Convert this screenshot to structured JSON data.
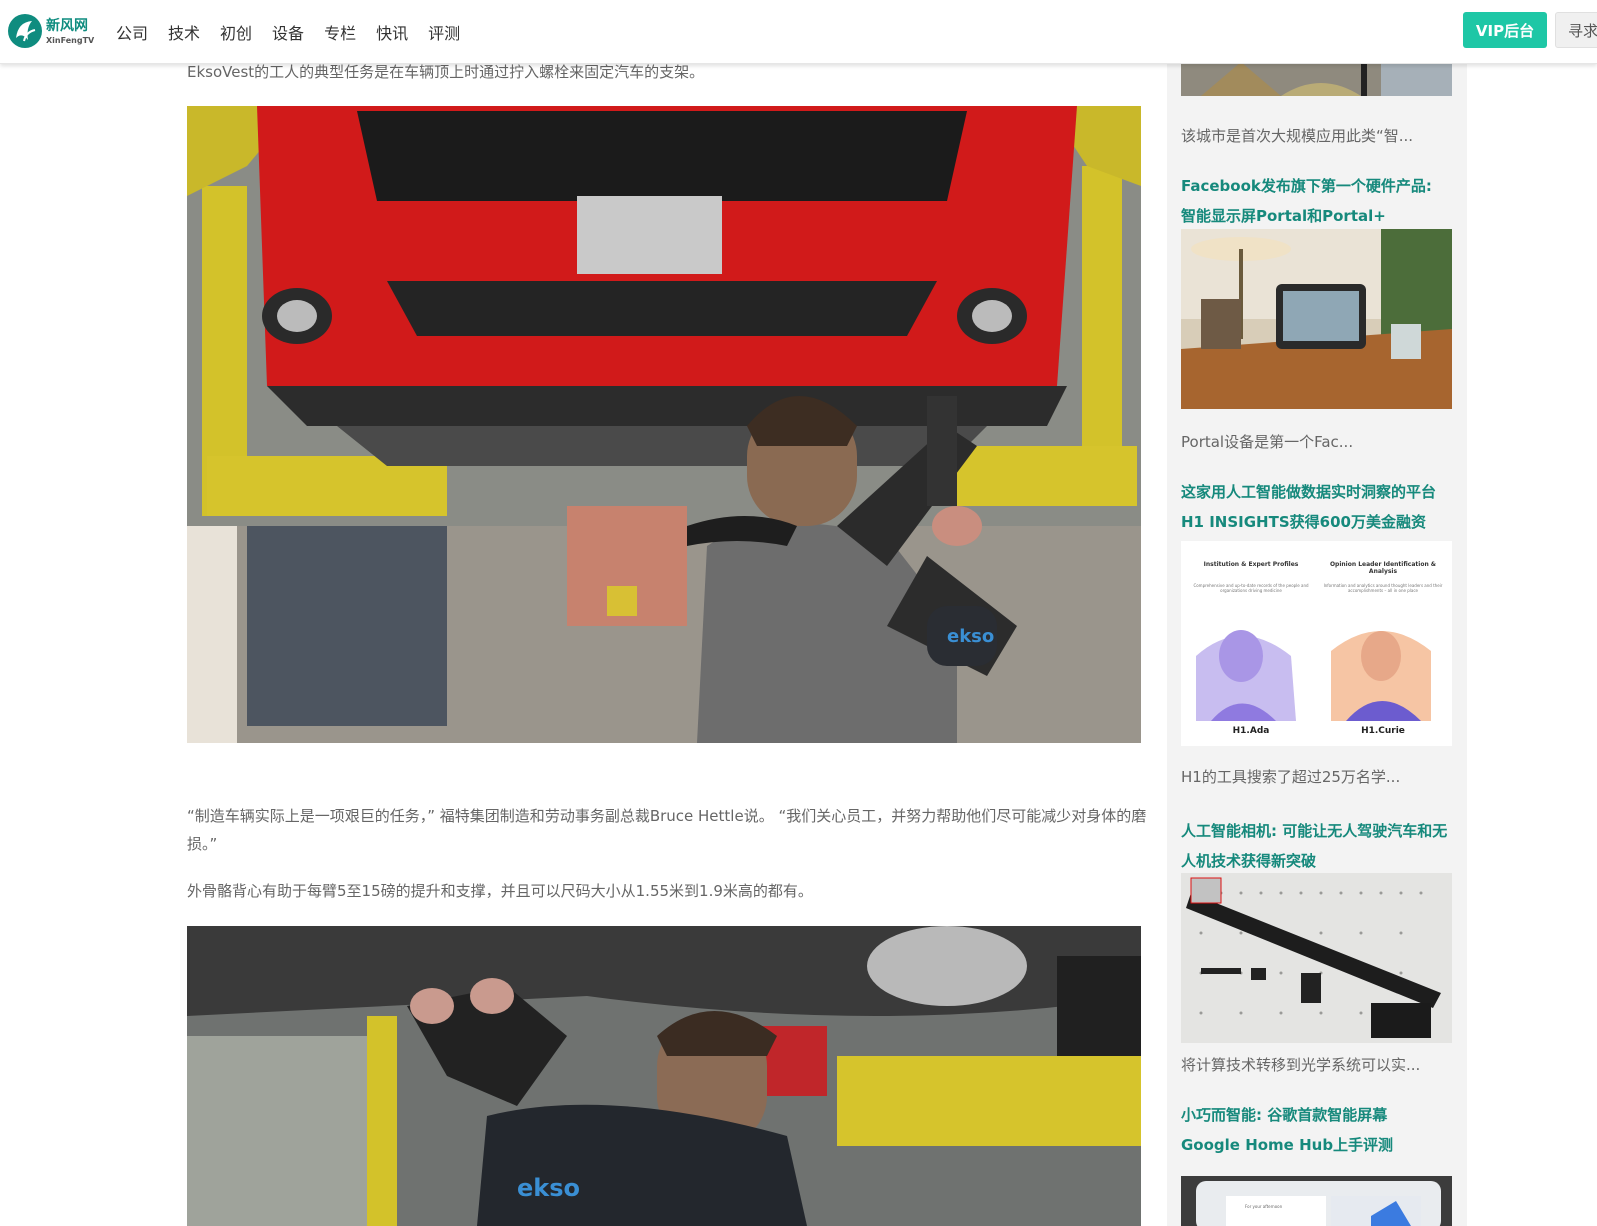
{
  "header": {
    "logo_cn": "新风网",
    "logo_en": "XinFengTV",
    "nav": [
      "公司",
      "技术",
      "初创",
      "设备",
      "专栏",
      "快讯",
      "评测"
    ],
    "vip_label": "VIP后台",
    "find_label": "寻求"
  },
  "article": {
    "para1": "EksoVest的工人的典型任务是在车辆顶上时通过拧入螺栓来固定汽车的支架。",
    "para2": "“制造车辆实际上是一项艰巨的任务，” 福特集团制造和劳动事务副总裁Bruce Hettle说。 “我们关心员工，并努力帮助他们尽可能减少对身体的磨损。”",
    "para3": "外骨骼背心有助于每臂5至15磅的提升和支撑，并且可以尺码大小从1.55米到1.9米高的都有。"
  },
  "sidebar": {
    "item0_desc": "该城市是首次大规模应用此类“智...",
    "item1_title": "Facebook发布旗下第一个硬件产品: 智能显示屏Portal和Portal+",
    "item1_desc": "Portal设备是第一个Fac...",
    "item2_title": "这家用人工智能做数据实时洞察的平台H1 INSIGHTS获得600万美金融资",
    "item2_desc": "H1的工具搜索了超过25万名学...",
    "item2_img": {
      "left_title": "Institution & Expert Profiles",
      "left_caption": "Comprehensive and up-to-date records of the people and organizations driving medicine",
      "left_label": "H1.Ada",
      "right_title": "Opinion Leader Identification & Analysis",
      "right_caption": "Information and analytics around thought leaders and their accomplishments – all in one place",
      "right_label": "H1.Curie"
    },
    "item3_title": "人工智能相机: 可能让无人驾驶汽车和无人机技术获得新突破",
    "item3_desc": "将计算技术转移到光学系统可以实...",
    "item4_title": "小巧而智能: 谷歌首款智能屏幕 Google Home Hub上手评测",
    "item4_img": {
      "screen_text": "For your afternoon"
    }
  }
}
